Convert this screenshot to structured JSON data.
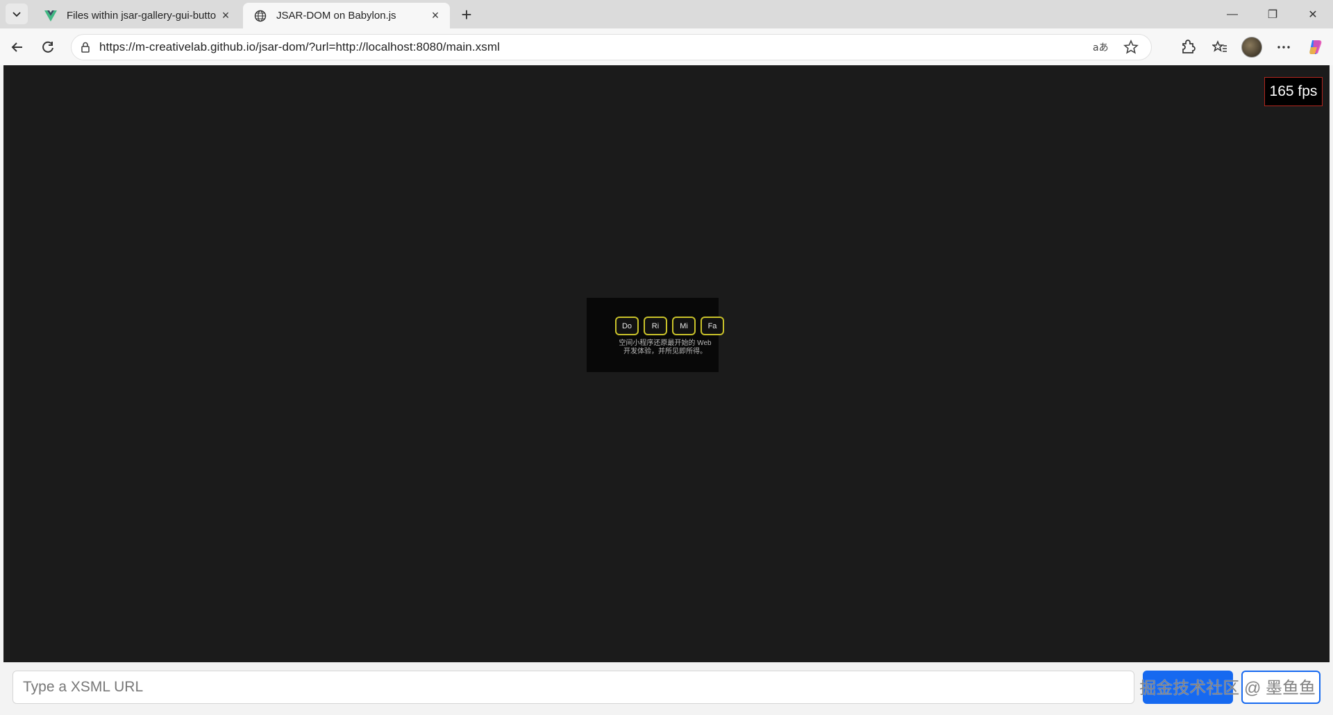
{
  "browser": {
    "tabs": [
      {
        "title": "Files within jsar-gallery-gui-butto",
        "icon": "vue-icon"
      },
      {
        "title": "JSAR-DOM on Babylon.js",
        "icon": "globe-icon"
      }
    ],
    "url": "https://m-creativelab.github.io/jsar-dom/?url=http://localhost:8080/main.xsml"
  },
  "app": {
    "fps": "165 fps",
    "notes": [
      "Do",
      "Ri",
      "Mi",
      "Fa"
    ],
    "scene_text_line1": "空间小程序还原最开始的 Web",
    "scene_text_line2": "开发体验，并所见即所得。",
    "url_input_placeholder": "Type a XSML URL",
    "watermark": "掘金技术社区 @ 墨鱼鱼",
    "colors": {
      "viewport_background": "#1b1b1b",
      "note_border": "#c9c22a",
      "primary_button": "#1669f0",
      "fps_border": "#b3261e"
    }
  }
}
